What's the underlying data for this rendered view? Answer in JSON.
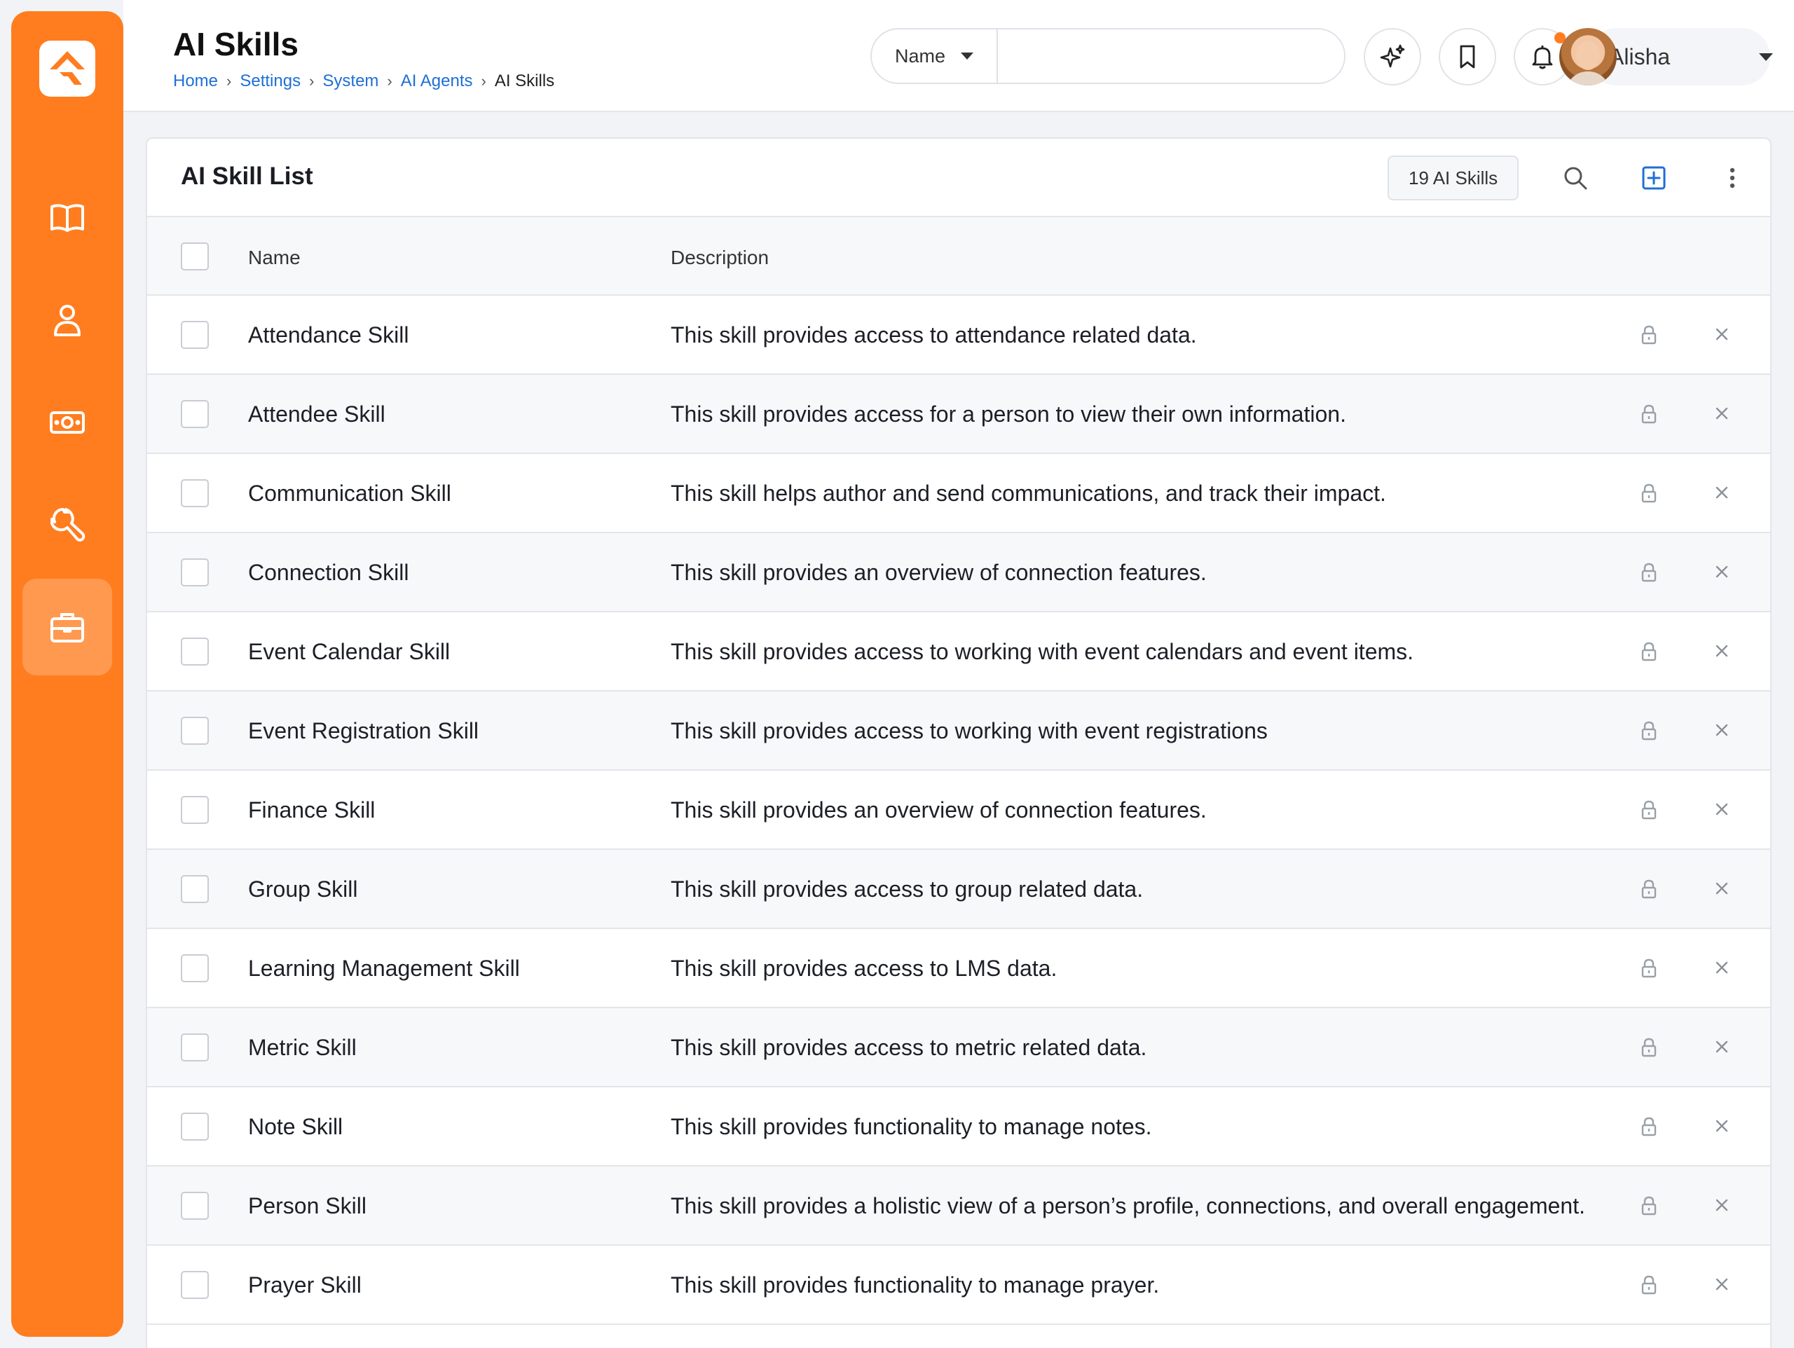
{
  "colors": {
    "accent": "#ff7d1f",
    "link": "#1f6fd6"
  },
  "sidebar": {
    "logo_icon": "rock-logo-icon",
    "items": [
      {
        "name": "book-icon",
        "active": false
      },
      {
        "name": "person-icon",
        "active": false
      },
      {
        "name": "money-icon",
        "active": false
      },
      {
        "name": "wrench-icon",
        "active": false
      },
      {
        "name": "briefcase-icon",
        "active": true
      }
    ]
  },
  "header": {
    "title": "AI Skills",
    "breadcrumb": [
      "Home",
      "Settings",
      "System",
      "AI Agents",
      "AI Skills"
    ],
    "search": {
      "filter_label": "Name",
      "value": "",
      "placeholder": ""
    },
    "user": {
      "name": "Alisha"
    }
  },
  "card": {
    "title": "AI Skill List",
    "count_label": "19 AI Skills",
    "columns": {
      "name": "Name",
      "description": "Description"
    },
    "rows": [
      {
        "name": "Attendance Skill",
        "description": "This skill provides access to attendance related data."
      },
      {
        "name": "Attendee Skill",
        "description": "This skill provides access for a person to view their own information."
      },
      {
        "name": "Communication Skill",
        "description": "This skill helps author and send communications, and track their impact."
      },
      {
        "name": "Connection Skill",
        "description": "This skill provides an overview of connection features."
      },
      {
        "name": "Event Calendar Skill",
        "description": "This skill provides access to working with event calendars and event items."
      },
      {
        "name": "Event Registration Skill",
        "description": "This skill provides access to working with event registrations"
      },
      {
        "name": "Finance Skill",
        "description": "This skill provides an overview of connection features."
      },
      {
        "name": "Group Skill",
        "description": "This skill provides access to group related data."
      },
      {
        "name": "Learning Management Skill",
        "description": "This skill provides access to LMS data."
      },
      {
        "name": "Metric Skill",
        "description": "This skill provides access to metric related data."
      },
      {
        "name": "Note Skill",
        "description": "This skill provides functionality to manage notes."
      },
      {
        "name": "Person Skill",
        "description": "This skill provides a holistic view of a person’s profile, connections, and overall engagement."
      },
      {
        "name": "Prayer Skill",
        "description": "This skill provides functionality to manage prayer."
      }
    ]
  }
}
